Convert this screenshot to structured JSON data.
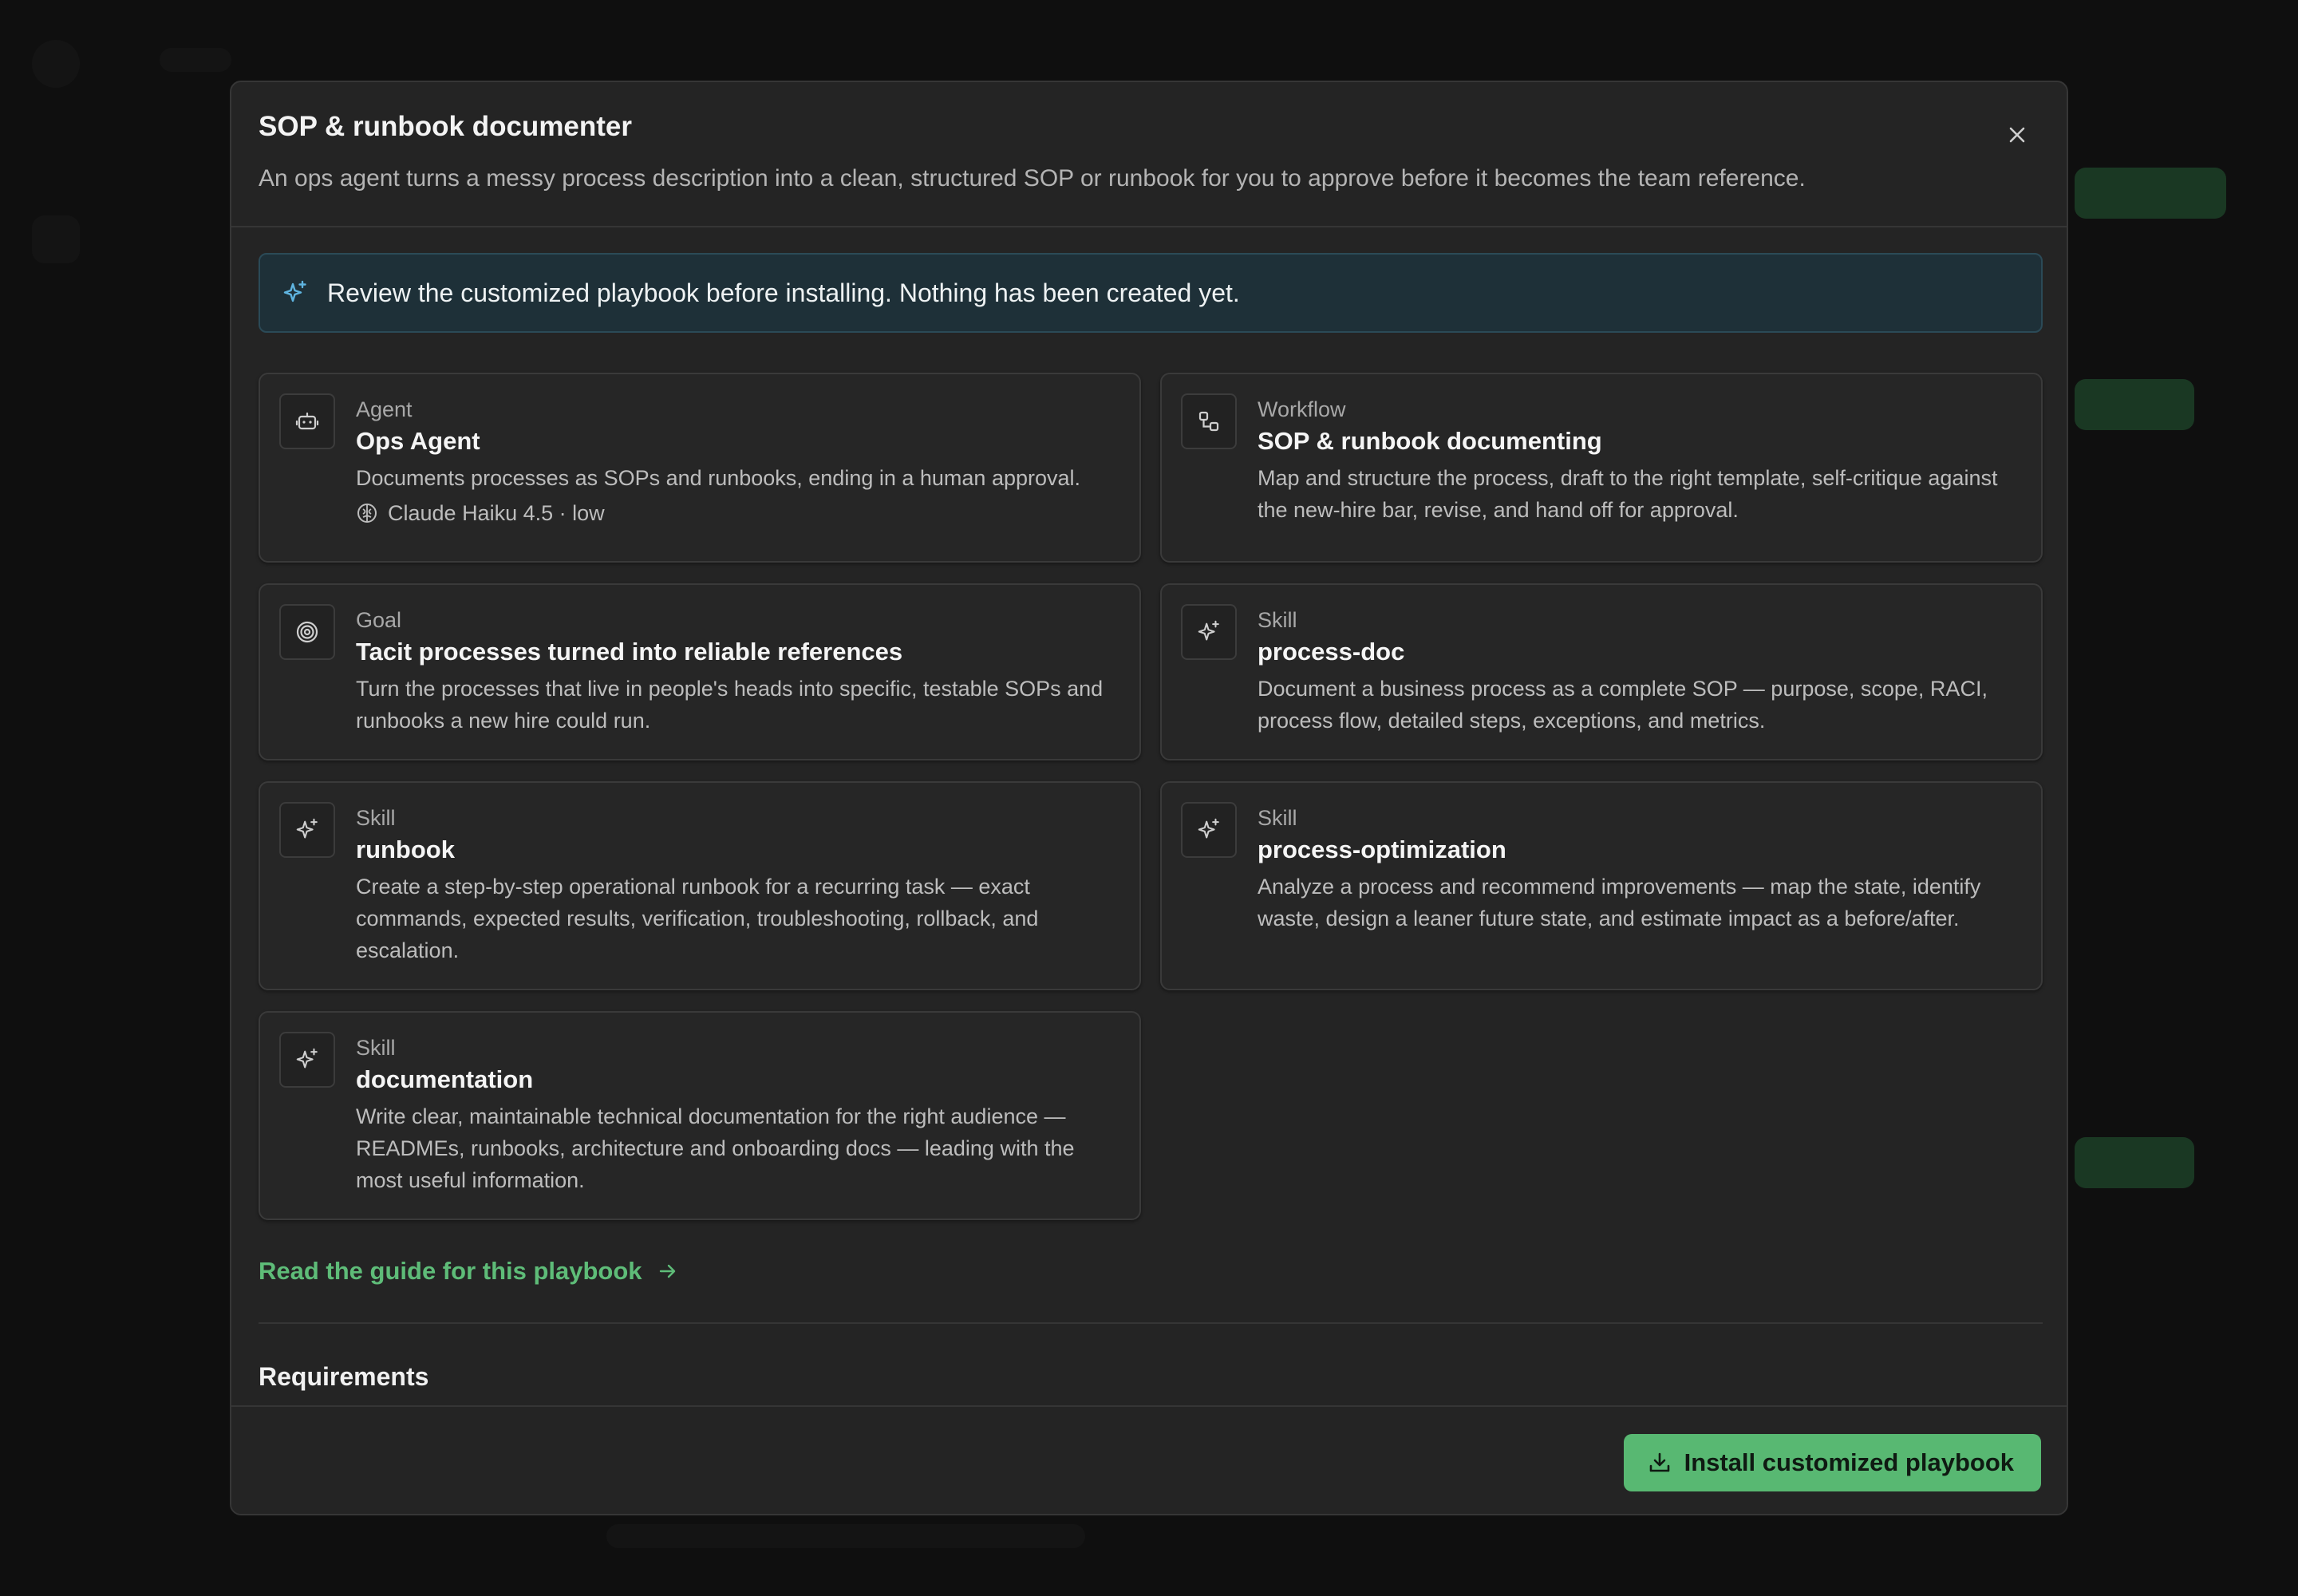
{
  "modal": {
    "title": "SOP & runbook documenter",
    "subtitle": "An ops agent turns a messy process description into a clean, structured SOP or runbook for you to approve before it becomes the team reference."
  },
  "notice": {
    "text": "Review the customized playbook before installing. Nothing has been created yet."
  },
  "cards": [
    {
      "kind": "Agent",
      "name": "Ops Agent",
      "description": "Documents processes as SOPs and runbooks, ending in a human approval.",
      "meta": "Claude Haiku 4.5 · low",
      "icon": "robot-icon"
    },
    {
      "kind": "Workflow",
      "name": "SOP & runbook documenting",
      "description": "Map and structure the process, draft to the right template, self-critique against the new-hire bar, revise, and hand off for approval.",
      "icon": "workflow-icon"
    },
    {
      "kind": "Goal",
      "name": "Tacit processes turned into reliable references",
      "description": "Turn the processes that live in people's heads into specific, testable SOPs and runbooks a new hire could run.",
      "icon": "target-icon"
    },
    {
      "kind": "Skill",
      "name": "process-doc",
      "description": "Document a business process as a complete SOP — purpose, scope, RACI, process flow, detailed steps, exceptions, and metrics.",
      "icon": "sparkle-icon"
    },
    {
      "kind": "Skill",
      "name": "runbook",
      "description": "Create a step-by-step operational runbook for a recurring task — exact commands, expected results, verification, troubleshooting, rollback, and escalation.",
      "icon": "sparkle-icon"
    },
    {
      "kind": "Skill",
      "name": "process-optimization",
      "description": "Analyze a process and recommend improvements — map the state, identify waste, design a leaner future state, and estimate impact as a before/after.",
      "icon": "sparkle-icon"
    },
    {
      "kind": "Skill",
      "name": "documentation",
      "description": "Write clear, maintainable technical documentation for the right audience — READMEs, runbooks, architecture and onboarding docs — leading with the most useful information.",
      "icon": "sparkle-icon"
    }
  ],
  "guide_link": "Read the guide for this playbook",
  "requirements_title": "Requirements",
  "install_button": "Install customized playbook",
  "colors": {
    "accent": "#58b872",
    "link": "#5ebc78",
    "notice_bg": "#1e3038",
    "modal_bg": "#242424"
  }
}
